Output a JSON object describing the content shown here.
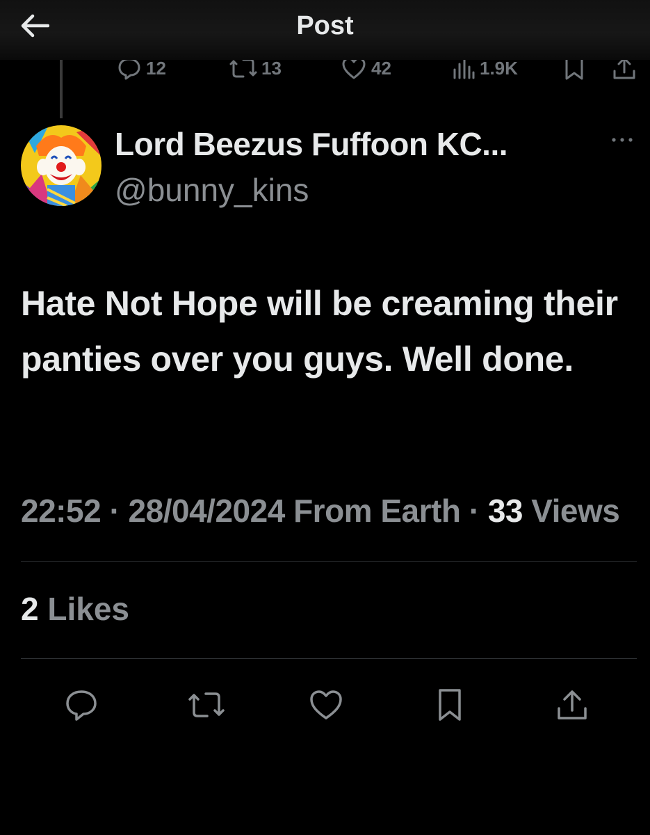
{
  "header": {
    "title": "Post"
  },
  "previous_post_actions": {
    "replies": "12",
    "reposts": "13",
    "likes": "42",
    "views": "1.9K"
  },
  "tweet": {
    "display_name": "Lord Beezus Fuffoon KC...",
    "handle": "@bunny_kins",
    "text": "Hate Not Hope will be creaming their panties over you guys. Well done.",
    "time": "22:52",
    "date": "28/04/2024",
    "source": "From Earth",
    "views_count": "33",
    "views_label": "Views",
    "likes_count": "2",
    "likes_label": "Likes"
  },
  "icons": {
    "back": "arrow-left-icon",
    "more": "more-horizontal-icon",
    "reply": "speech-bubble-icon",
    "repost": "repost-arrows-icon",
    "like": "heart-icon",
    "views": "bar-chart-icon",
    "bookmark": "bookmark-icon",
    "share": "share-upload-icon"
  },
  "colors": {
    "background": "#000000",
    "primary_text": "#e7e9ea",
    "secondary_text": "#8b8f93",
    "divider": "#2f3336"
  }
}
